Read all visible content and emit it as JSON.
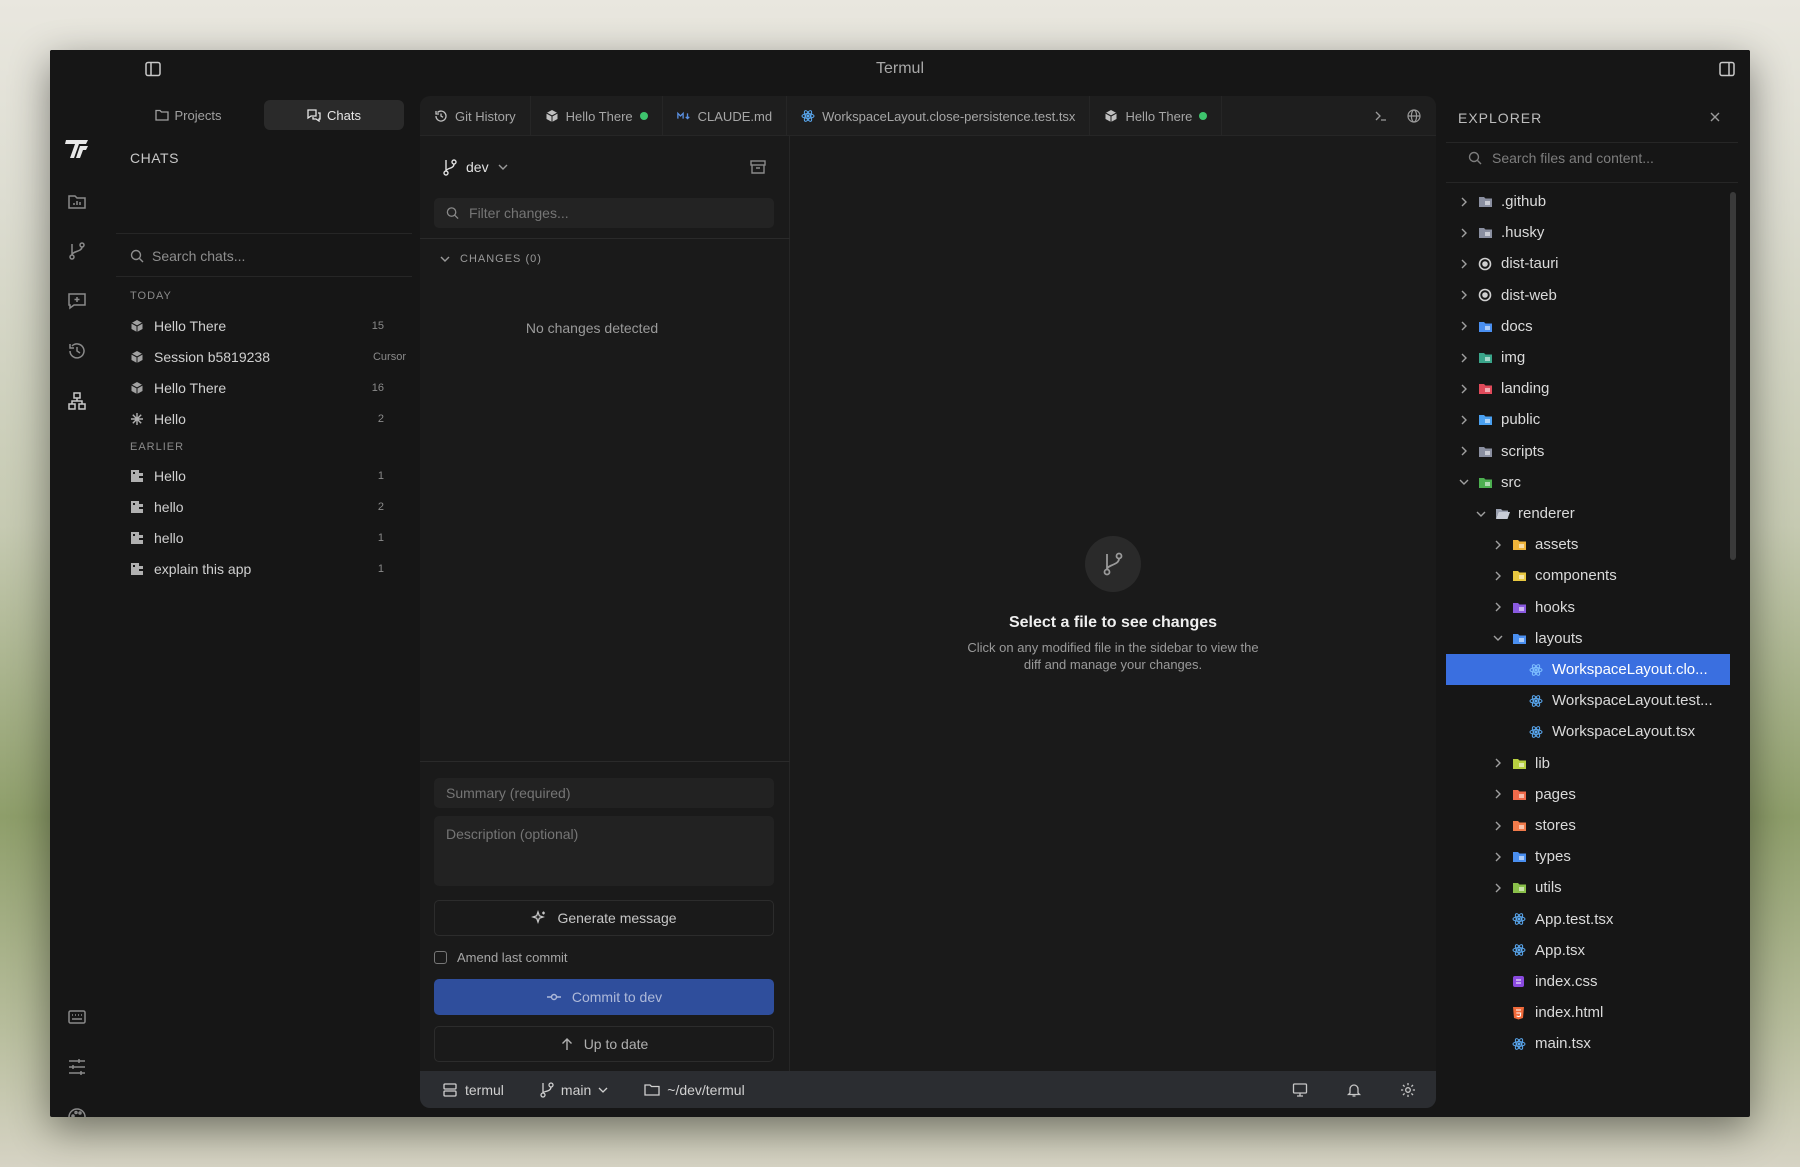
{
  "window": {
    "title": "Termul"
  },
  "sidebar": {
    "tabs": [
      {
        "label": "Projects",
        "icon": "folder-icon",
        "active": false
      },
      {
        "label": "Chats",
        "icon": "chats-icon",
        "active": true
      }
    ],
    "heading": "CHATS",
    "search_placeholder": "Search chats...",
    "groups": [
      {
        "label": "TODAY",
        "items": [
          {
            "label": "Hello There",
            "count": "15",
            "icon": "cube-icon"
          },
          {
            "label": "Session b5819238",
            "count": "Cursor",
            "icon": "cube-icon"
          },
          {
            "label": "Hello There",
            "count": "16",
            "icon": "cube-icon"
          },
          {
            "label": "Hello",
            "count": "2",
            "icon": "spark-icon"
          }
        ]
      },
      {
        "label": "EARLIER",
        "items": [
          {
            "label": "Hello",
            "count": "1",
            "icon": "agent-icon"
          },
          {
            "label": "hello",
            "count": "2",
            "icon": "agent-icon"
          },
          {
            "label": "hello",
            "count": "1",
            "icon": "agent-icon"
          },
          {
            "label": "explain this app",
            "count": "1",
            "icon": "agent-icon"
          }
        ]
      }
    ]
  },
  "tabs": [
    {
      "label": "Git History",
      "icon": "history-icon",
      "dot": false
    },
    {
      "label": "Hello There",
      "icon": "cube-icon",
      "dot": true
    },
    {
      "label": "CLAUDE.md",
      "icon": "markdown-icon",
      "dot": false
    },
    {
      "label": "WorkspaceLayout.close-persistence.test.tsx",
      "icon": "react-icon",
      "dot": false
    },
    {
      "label": "Hello There",
      "icon": "cube-icon",
      "dot": true
    }
  ],
  "changes": {
    "branch": "dev",
    "filter_placeholder": "Filter changes...",
    "section_label": "CHANGES (0)",
    "empty_text": "No changes detected",
    "summary_placeholder": "Summary (required)",
    "description_placeholder": "Description (optional)",
    "generate_label": "Generate message",
    "amend_label": "Amend last commit",
    "commit_label": "Commit to dev",
    "update_label": "Up to date"
  },
  "diff": {
    "title": "Select a file to see changes",
    "subtitle": "Click on any modified file in the sidebar to view the diff and manage your changes."
  },
  "status": {
    "workspace": "termul",
    "branch": "main",
    "path": "~/dev/termul"
  },
  "explorer": {
    "title": "EXPLORER",
    "search_placeholder": "Search files and content...",
    "nodes": [
      {
        "label": ".github",
        "depth": 0,
        "type": "folder",
        "expanded": false,
        "color": "#8a8fa0"
      },
      {
        "label": ".husky",
        "depth": 0,
        "type": "folder",
        "expanded": false,
        "color": "#8a8fa0"
      },
      {
        "label": "dist-tauri",
        "depth": 0,
        "type": "circle",
        "expanded": false,
        "color": "#cfcfcf"
      },
      {
        "label": "dist-web",
        "depth": 0,
        "type": "circle",
        "expanded": false,
        "color": "#cfcfcf"
      },
      {
        "label": "docs",
        "depth": 0,
        "type": "folder",
        "expanded": false,
        "color": "#4a8ff0"
      },
      {
        "label": "img",
        "depth": 0,
        "type": "folder",
        "expanded": false,
        "color": "#3aa58a"
      },
      {
        "label": "landing",
        "depth": 0,
        "type": "folder",
        "expanded": false,
        "color": "#e04a5a"
      },
      {
        "label": "public",
        "depth": 0,
        "type": "folder",
        "expanded": false,
        "color": "#4aa0f0"
      },
      {
        "label": "scripts",
        "depth": 0,
        "type": "folder",
        "expanded": false,
        "color": "#8a8fa0"
      },
      {
        "label": "src",
        "depth": 0,
        "type": "folder",
        "expanded": true,
        "color": "#4caf50"
      },
      {
        "label": "renderer",
        "depth": 1,
        "type": "folder-open",
        "expanded": true,
        "color": "#9aa0b0"
      },
      {
        "label": "assets",
        "depth": 2,
        "type": "folder",
        "expanded": false,
        "color": "#f0b43a"
      },
      {
        "label": "components",
        "depth": 2,
        "type": "folder",
        "expanded": false,
        "color": "#e8c840"
      },
      {
        "label": "hooks",
        "depth": 2,
        "type": "folder",
        "expanded": false,
        "color": "#8a5ae0"
      },
      {
        "label": "layouts",
        "depth": 2,
        "type": "folder",
        "expanded": true,
        "color": "#4a8ff0"
      },
      {
        "label": "WorkspaceLayout.clo...",
        "depth": 3,
        "type": "react",
        "selected": true,
        "color": "#5aa8f0"
      },
      {
        "label": "WorkspaceLayout.test...",
        "depth": 3,
        "type": "react",
        "color": "#5aa8f0"
      },
      {
        "label": "WorkspaceLayout.tsx",
        "depth": 3,
        "type": "react",
        "color": "#5aa8f0"
      },
      {
        "label": "lib",
        "depth": 2,
        "type": "folder",
        "expanded": false,
        "color": "#b8d040"
      },
      {
        "label": "pages",
        "depth": 2,
        "type": "folder",
        "expanded": false,
        "color": "#f06a4a"
      },
      {
        "label": "stores",
        "depth": 2,
        "type": "folder",
        "expanded": false,
        "color": "#f07a4a"
      },
      {
        "label": "types",
        "depth": 2,
        "type": "folder",
        "expanded": false,
        "color": "#4a8ff0"
      },
      {
        "label": "utils",
        "depth": 2,
        "type": "folder",
        "expanded": false,
        "color": "#8ac04a"
      },
      {
        "label": "App.test.tsx",
        "depth": 2,
        "type": "react",
        "file": true,
        "color": "#5aa8f0"
      },
      {
        "label": "App.tsx",
        "depth": 2,
        "type": "react",
        "file": true,
        "color": "#5aa8f0"
      },
      {
        "label": "index.css",
        "depth": 2,
        "type": "css",
        "file": true,
        "color": "#8a4ae0"
      },
      {
        "label": "index.html",
        "depth": 2,
        "type": "html",
        "file": true,
        "color": "#f06a3a"
      },
      {
        "label": "main.tsx",
        "depth": 2,
        "type": "react",
        "file": true,
        "color": "#5aa8f0"
      }
    ]
  },
  "colors": {
    "accent": "#3a6fe0",
    "commit": "#2f4e9c",
    "dot": "#3ec46d"
  }
}
